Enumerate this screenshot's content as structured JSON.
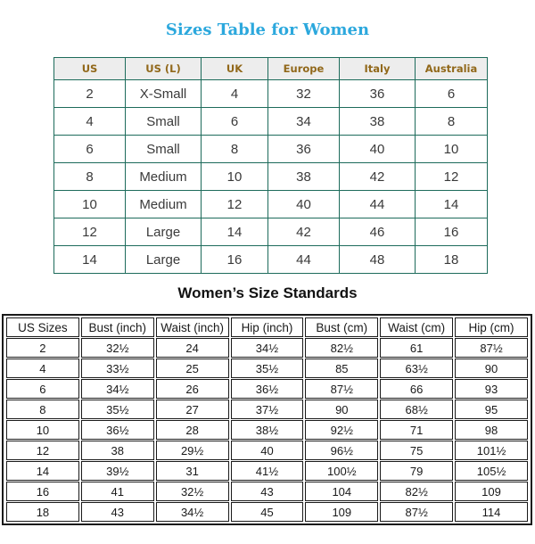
{
  "section_one": {
    "title": "Sizes Table for Women",
    "title_color": "#2ca8dd",
    "border_color": "#1d6b5b",
    "header_bg": "#ededed",
    "header_text_color": "#91681a",
    "columns": [
      "US",
      "US (L)",
      "UK",
      "Europe",
      "Italy",
      "Australia"
    ],
    "rows": [
      [
        "2",
        "X-Small",
        "4",
        "32",
        "36",
        "6"
      ],
      [
        "4",
        "Small",
        "6",
        "34",
        "38",
        "8"
      ],
      [
        "6",
        "Small",
        "8",
        "36",
        "40",
        "10"
      ],
      [
        "8",
        "Medium",
        "10",
        "38",
        "42",
        "12"
      ],
      [
        "10",
        "Medium",
        "12",
        "40",
        "44",
        "14"
      ],
      [
        "12",
        "Large",
        "14",
        "42",
        "46",
        "16"
      ],
      [
        "14",
        "Large",
        "16",
        "44",
        "48",
        "18"
      ]
    ]
  },
  "section_two": {
    "title": "Women’s Size Standards",
    "title_color": "#121212",
    "border_color": "#1a1a1a",
    "columns": [
      "US Sizes",
      "Bust (inch)",
      "Waist (inch)",
      "Hip (inch)",
      "Bust (cm)",
      "Waist (cm)",
      "Hip (cm)"
    ],
    "rows": [
      [
        "2",
        "32½",
        "24",
        "34½",
        "82½",
        "61",
        "87½"
      ],
      [
        "4",
        "33½",
        "25",
        "35½",
        "85",
        "63½",
        "90"
      ],
      [
        "6",
        "34½",
        "26",
        "36½",
        "87½",
        "66",
        "93"
      ],
      [
        "8",
        "35½",
        "27",
        "37½",
        "90",
        "68½",
        "95"
      ],
      [
        "10",
        "36½",
        "28",
        "38½",
        "92½",
        "71",
        "98"
      ],
      [
        "12",
        "38",
        "29½",
        "40",
        "96½",
        "75",
        "101½"
      ],
      [
        "14",
        "39½",
        "31",
        "41½",
        "100½",
        "79",
        "105½"
      ],
      [
        "16",
        "41",
        "32½",
        "43",
        "104",
        "82½",
        "109"
      ],
      [
        "18",
        "43",
        "34½",
        "45",
        "109",
        "87½",
        "114"
      ]
    ]
  },
  "chart_data": [
    {
      "type": "table",
      "title": "Sizes Table for Women",
      "columns": [
        "US",
        "US (L)",
        "UK",
        "Europe",
        "Italy",
        "Australia"
      ],
      "rows": [
        [
          "2",
          "X-Small",
          "4",
          "32",
          "36",
          "6"
        ],
        [
          "4",
          "Small",
          "6",
          "34",
          "38",
          "8"
        ],
        [
          "6",
          "Small",
          "8",
          "36",
          "40",
          "10"
        ],
        [
          "8",
          "Medium",
          "10",
          "38",
          "42",
          "12"
        ],
        [
          "10",
          "Medium",
          "12",
          "40",
          "44",
          "14"
        ],
        [
          "12",
          "Large",
          "14",
          "42",
          "46",
          "16"
        ],
        [
          "14",
          "Large",
          "16",
          "44",
          "48",
          "18"
        ]
      ]
    },
    {
      "type": "table",
      "title": "Women’s Size Standards",
      "columns": [
        "US Sizes",
        "Bust (inch)",
        "Waist (inch)",
        "Hip (inch)",
        "Bust (cm)",
        "Waist (cm)",
        "Hip (cm)"
      ],
      "rows": [
        [
          "2",
          "32½",
          "24",
          "34½",
          "82½",
          "61",
          "87½"
        ],
        [
          "4",
          "33½",
          "25",
          "35½",
          "85",
          "63½",
          "90"
        ],
        [
          "6",
          "34½",
          "26",
          "36½",
          "87½",
          "66",
          "93"
        ],
        [
          "8",
          "35½",
          "27",
          "37½",
          "90",
          "68½",
          "95"
        ],
        [
          "10",
          "36½",
          "28",
          "38½",
          "92½",
          "71",
          "98"
        ],
        [
          "12",
          "38",
          "29½",
          "40",
          "96½",
          "75",
          "101½"
        ],
        [
          "14",
          "39½",
          "31",
          "41½",
          "100½",
          "79",
          "105½"
        ],
        [
          "16",
          "41",
          "32½",
          "43",
          "104",
          "82½",
          "109"
        ],
        [
          "18",
          "43",
          "34½",
          "45",
          "109",
          "87½",
          "114"
        ]
      ]
    }
  ]
}
